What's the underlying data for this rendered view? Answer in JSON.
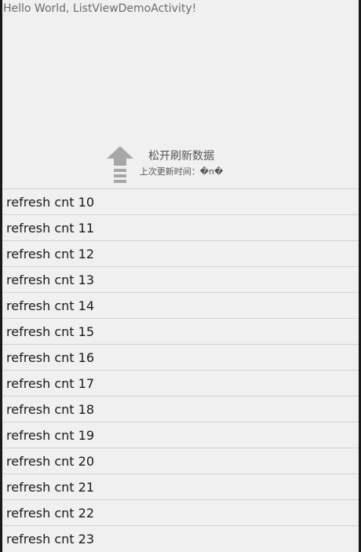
{
  "app": {
    "hello_text": "Hello World, ListViewDemoActivity!"
  },
  "pull_header": {
    "icon": "up-arrow-icon",
    "status_text": "松开刷新数据",
    "last_updated_text": "上次更新时间：�n�"
  },
  "list": {
    "items": [
      {
        "label": "refresh cnt 10"
      },
      {
        "label": "refresh cnt 11"
      },
      {
        "label": "refresh cnt 12"
      },
      {
        "label": "refresh cnt 13"
      },
      {
        "label": "refresh cnt 14"
      },
      {
        "label": "refresh cnt 15"
      },
      {
        "label": "refresh cnt 16"
      },
      {
        "label": "refresh cnt 17"
      },
      {
        "label": "refresh cnt 18"
      },
      {
        "label": "refresh cnt 19"
      },
      {
        "label": "refresh cnt 20"
      },
      {
        "label": "refresh cnt 21"
      },
      {
        "label": "refresh cnt 22"
      },
      {
        "label": "refresh cnt 23"
      }
    ]
  },
  "colors": {
    "background": "#f0f0f0",
    "divider": "#d2d2d2",
    "arrow": "#a7a7a7"
  }
}
